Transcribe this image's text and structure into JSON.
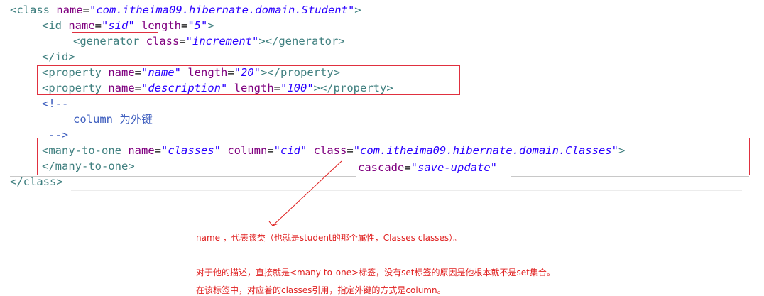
{
  "code": {
    "l1": {
      "open": "<class ",
      "attr": "name",
      "val": "\"com.itheima09.hibernate.domain.Student\"",
      "close": ">"
    },
    "l2": {
      "open": "<id ",
      "attr1": "name",
      "val1": "\"sid\"",
      "attr2": " length",
      "val2": "\"5\"",
      "close": ">"
    },
    "l3": {
      "open": "<generator ",
      "attr": "class",
      "val": "\"increment\"",
      "close": "></generator>"
    },
    "l4": {
      "text": "</id>"
    },
    "l5": {
      "open": "<property ",
      "attr1": "name",
      "val1": "\"name\"",
      "attr2": " length",
      "val2": "\"20\"",
      "close": "></property>"
    },
    "l6": {
      "open": "<property ",
      "attr1": "name",
      "val1": "\"description\"",
      "attr2": " length",
      "val2": "\"100\"",
      "close": "></property>"
    },
    "l7": {
      "text": "<!--"
    },
    "l8": {
      "text": "column 为外键"
    },
    "l9": {
      "text": "-->"
    },
    "l10": {
      "open": "<many-to-one ",
      "attr1": "name",
      "val1": "\"classes\"",
      "attr2": " column",
      "val2": "\"cid\"",
      "attr3": " class",
      "val3": "\"com.itheima09.hibernate.domain.Classes\"",
      "close": ">"
    },
    "l11": {
      "text": "</many-to-one>"
    },
    "l12": {
      "text": "</class>"
    },
    "cascade": {
      "attr": "cascade",
      "val": "\"save-update\""
    },
    "eq": "="
  },
  "notes": {
    "n1": "name ，代表该类（也就是student的那个属性，Classes classes）。",
    "n2": "对于他的描述，直接就是<many-to-one>标签，没有set标签的原因是他根本就不是set集合。",
    "n3": "在该标签中，对应着的classes引用，指定外键的方式是column。"
  },
  "colors": {
    "tag": "#3f7f7f",
    "attr": "#7f007f",
    "value": "#2a00ff",
    "comment": "#3f5fbf",
    "annotation": "#e02020"
  }
}
